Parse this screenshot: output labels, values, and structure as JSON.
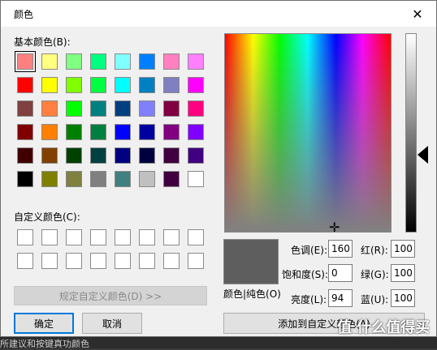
{
  "window": {
    "title": "颜色"
  },
  "basic_colors_label": "基本颜色(B):",
  "custom_colors_label": "自定义颜色(C):",
  "basic_colors": [
    "#ff8080",
    "#ffff80",
    "#80ff80",
    "#00ff80",
    "#80ffff",
    "#0080ff",
    "#ff80c0",
    "#ff80ff",
    "#ff0000",
    "#ffff00",
    "#80ff00",
    "#00ff40",
    "#00ffff",
    "#0080c0",
    "#8080c0",
    "#ff00ff",
    "#804040",
    "#ff8040",
    "#00ff00",
    "#008080",
    "#004080",
    "#8080ff",
    "#800040",
    "#ff0080",
    "#800000",
    "#ff8000",
    "#008000",
    "#008040",
    "#0000ff",
    "#0000a0",
    "#800080",
    "#8000ff",
    "#400000",
    "#804000",
    "#004000",
    "#004040",
    "#000080",
    "#000040",
    "#400040",
    "#400080",
    "#000000",
    "#808000",
    "#808040",
    "#808080",
    "#408080",
    "#c0c0c0",
    "#400040",
    "#ffffff"
  ],
  "buttons": {
    "define_custom": "规定自定义颜色(D) >>",
    "ok": "确定",
    "cancel": "取消",
    "add_custom": "添加到自定义颜色(A)"
  },
  "color_solid_label": "颜色|纯色(O)",
  "fields": {
    "hue_label": "色调(E):",
    "hue": "160",
    "sat_label": "饱和度(S):",
    "sat": "0",
    "lum_label": "亮度(L):",
    "lum": "94",
    "red_label": "红(R):",
    "red": "100",
    "green_label": "绿(G):",
    "green": "100",
    "blue_label": "蓝(U):",
    "blue": "100"
  },
  "current_color": "#5e5e5e",
  "background_strip_text": "所建议和按键真功颜色",
  "watermark": "值 什么值得买"
}
